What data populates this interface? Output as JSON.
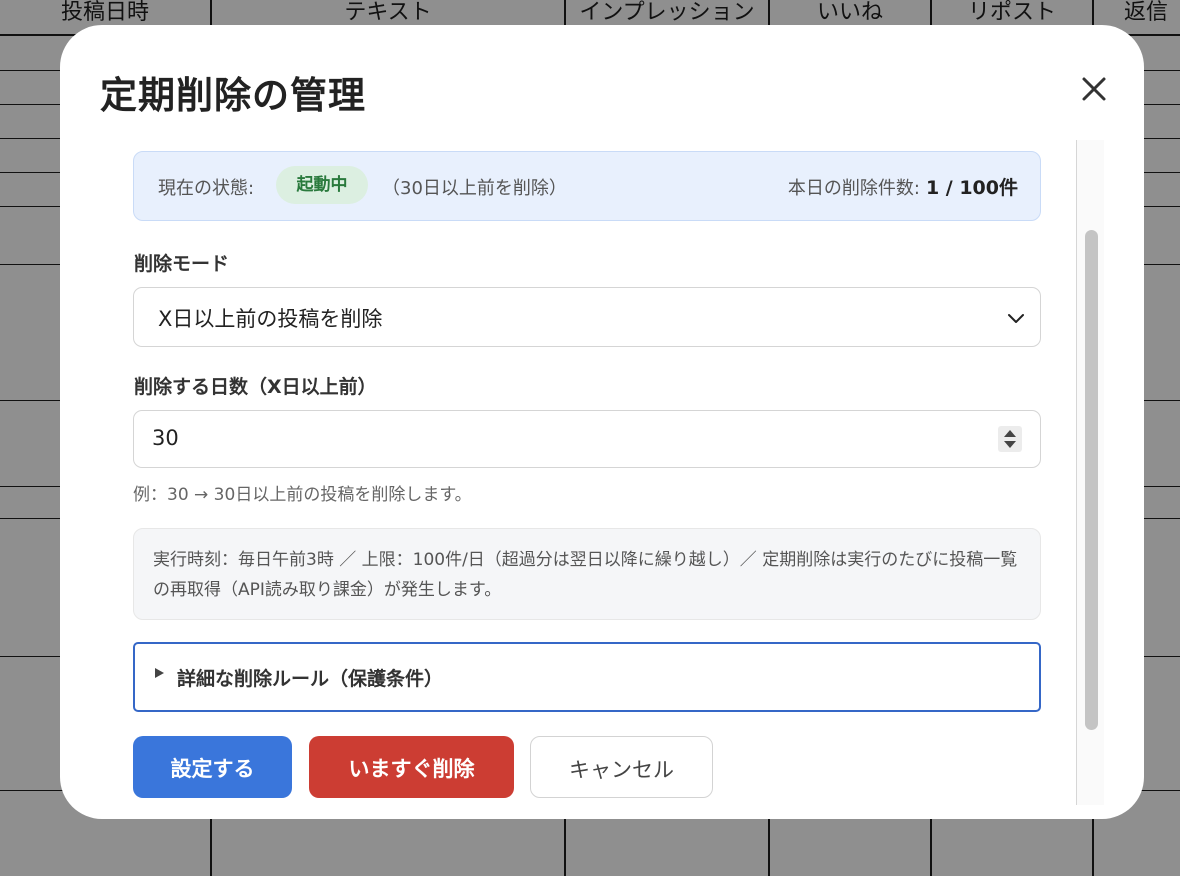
{
  "background_table": {
    "headers": [
      "投稿日時",
      "テキスト",
      "インプレッション",
      "いいね",
      "リポスト",
      "返信"
    ]
  },
  "modal": {
    "title": "定期削除の管理",
    "close_icon": "close-icon",
    "status": {
      "label": "現在の状態:",
      "badge": "起動中",
      "note": "（30日以上前を削除）",
      "count_label": "本日の削除件数:",
      "count_value": "1 / 100件"
    },
    "mode": {
      "label": "削除モード",
      "selected": "X日以上前の投稿を削除"
    },
    "days": {
      "label": "削除する日数（X日以上前）",
      "value": "30",
      "hint": "例：30 → 30日以上前の投稿を削除します。"
    },
    "info": "実行時刻：毎日午前3時 ／ 上限：100件/日（超過分は翌日以降に繰り越し）／ 定期削除は実行のたびに投稿一覧の再取得（API読み取り課金）が発生します。",
    "details": {
      "label": "詳細な削除ルール（保護条件）"
    },
    "buttons": {
      "save": "設定する",
      "delete_now": "いますぐ削除",
      "cancel": "キャンセル"
    }
  },
  "colors": {
    "primary": "#3a76db",
    "danger": "#cc3d33",
    "status_box": "#e8f0fd",
    "badge_bg": "#dcefe1",
    "badge_text": "#2a7a3d"
  }
}
